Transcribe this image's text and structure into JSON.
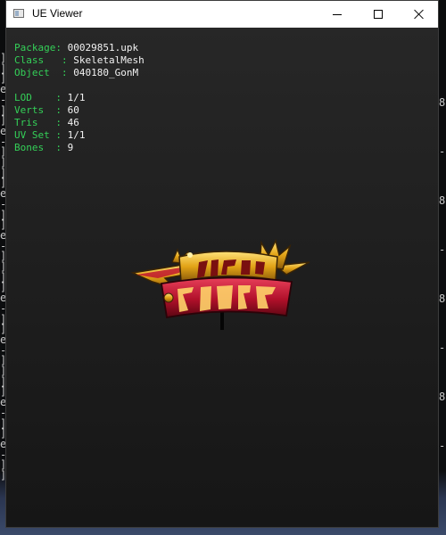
{
  "window": {
    "title": "UE Viewer"
  },
  "mesh_info": {
    "package": {
      "key": "Package",
      "value": "00029851.upk"
    },
    "class": {
      "key": "Class",
      "value": "SkeletalMesh"
    },
    "object": {
      "key": "Object",
      "value": "040180_GonM"
    },
    "lod": {
      "key": "LOD",
      "value": "1/1"
    },
    "verts": {
      "key": "Verts",
      "value": "60"
    },
    "tris": {
      "key": "Tris",
      "value": "46"
    },
    "uv_set": {
      "key": "UV Set",
      "value": "1/1"
    },
    "bones": {
      "key": "Bones",
      "value": "9"
    }
  },
  "model": {
    "logo_text": "시간의 지배자"
  },
  "colors": {
    "key_text": "#34d058",
    "value_text": "#f2f2f2",
    "viewport_bg": "#1f1f1f",
    "logo_red": "#b0102a",
    "logo_gold": "#e2a316"
  },
  "background_console": {
    "left_glyphs": [
      "]",
      "]",
      "]",
      "e",
      "-",
      "]",
      "]",
      "e",
      "-",
      "]",
      "]",
      "]",
      "]",
      "e",
      "-",
      "]",
      "]",
      "e",
      "-",
      "]",
      "]",
      "]",
      "]",
      "e",
      "-",
      "]",
      "]",
      "e",
      "-",
      "]",
      "]",
      "]",
      "]",
      "e",
      "-",
      "]",
      "]",
      "e",
      "-",
      "]",
      "]"
    ],
    "right_glyphs": [
      "8",
      "-",
      "8",
      "-",
      "8",
      "-",
      "8",
      "-"
    ]
  }
}
